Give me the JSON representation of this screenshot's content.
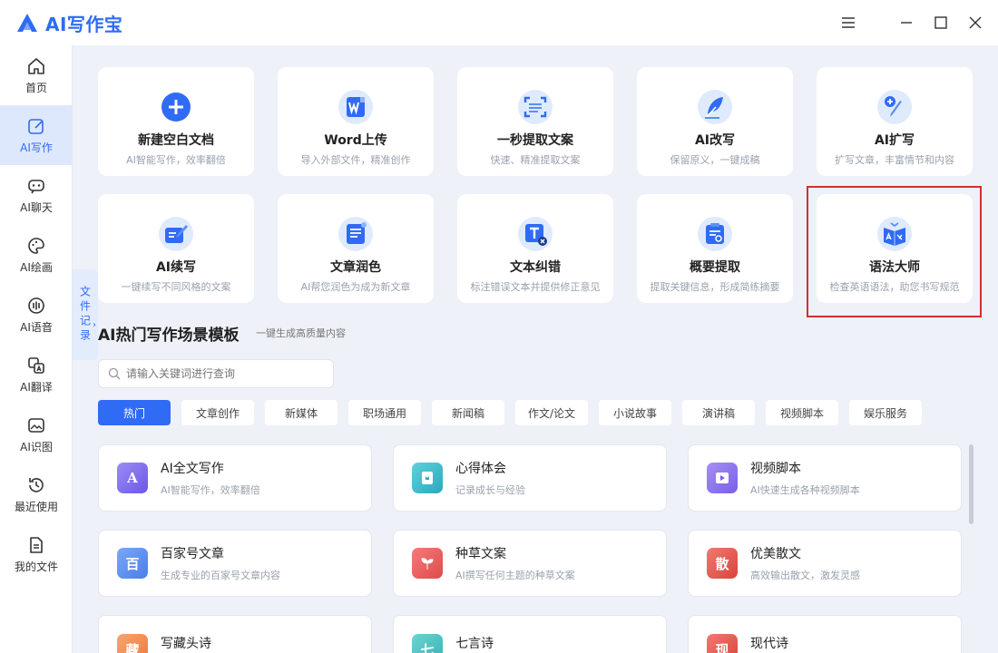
{
  "app": {
    "title": "AI写作宝"
  },
  "colors": {
    "accent": "#2f6bf5",
    "highlight": "#d32f2f"
  },
  "window_controls": [
    "menu-icon",
    "minimize-icon",
    "maximize-icon",
    "close-icon"
  ],
  "sidebar": {
    "items": [
      {
        "label": "首页",
        "icon": "home-icon"
      },
      {
        "label": "AI写作",
        "icon": "edit-icon",
        "active": true
      },
      {
        "label": "AI聊天",
        "icon": "chat-icon"
      },
      {
        "label": "AI绘画",
        "icon": "palette-icon"
      },
      {
        "label": "AI语音",
        "icon": "voice-icon"
      },
      {
        "label": "AI翻译",
        "icon": "translate-icon"
      },
      {
        "label": "AI识图",
        "icon": "image-icon"
      },
      {
        "label": "最近使用",
        "icon": "history-icon"
      },
      {
        "label": "我的文件",
        "icon": "file-icon"
      }
    ]
  },
  "side_tab": {
    "label": "文件记录"
  },
  "tools": [
    {
      "title": "新建空白文档",
      "desc": "AI智能写作，效率翻倍",
      "icon": "plus-icon"
    },
    {
      "title": "Word上传",
      "desc": "导入外部文件，精准创作",
      "icon": "word-icon"
    },
    {
      "title": "一秒提取文案",
      "desc": "快速、精准提取文案",
      "icon": "scan-icon"
    },
    {
      "title": "AI改写",
      "desc": "保留原义，一键成稿",
      "icon": "feather-icon"
    },
    {
      "title": "AI扩写",
      "desc": "扩写文章，丰富情节和内容",
      "icon": "pen-expand-icon"
    },
    {
      "title": "AI续写",
      "desc": "一键续写不同风格的文案",
      "icon": "book-pen-icon"
    },
    {
      "title": "文章润色",
      "desc": "AI帮您润色为成为新文章",
      "icon": "document-icon"
    },
    {
      "title": "文本纠错",
      "desc": "标注错误文本并提供修正意见",
      "icon": "text-check-icon"
    },
    {
      "title": "概要提取",
      "desc": "提取关键信息，形成简练摘要",
      "icon": "clipboard-search-icon"
    },
    {
      "title": "语法大师",
      "desc": "检查英语语法，助您书写规范",
      "icon": "grammar-book-icon"
    }
  ],
  "templates_section": {
    "title": "AI热门写作场景模板",
    "subtitle": "一键生成高质量内容",
    "search_placeholder": "请输入关键词进行查询",
    "chips": [
      "热门",
      "文章创作",
      "新媒体",
      "职场通用",
      "新闻稿",
      "作文/论文",
      "小说故事",
      "演讲稿",
      "视频脚本",
      "娱乐服务"
    ],
    "active_chip": "热门",
    "cards": [
      {
        "title": "AI全文写作",
        "desc": "AI智能写作，效率翻倍",
        "glyph": "A",
        "color": "#7b6cf0"
      },
      {
        "title": "心得体会",
        "desc": "记录成长与经验",
        "glyph": "▯",
        "color": "#34b7c9"
      },
      {
        "title": "视频脚本",
        "desc": "AI快速生成各种视频脚本",
        "glyph": "▶",
        "color": "#8a6ee8"
      },
      {
        "title": "百家号文章",
        "desc": "生成专业的百家号文章内容",
        "glyph": "百",
        "color": "#4f87f0"
      },
      {
        "title": "种草文案",
        "desc": "AI撰写任何主题的种草文案",
        "glyph": "❦",
        "color": "#ef5a5a"
      },
      {
        "title": "优美散文",
        "desc": "高效输出散文，激发灵感",
        "glyph": "散",
        "color": "#e85a5a"
      },
      {
        "title": "写藏头诗",
        "desc": "",
        "glyph": "藏",
        "color": "#f08a4a"
      },
      {
        "title": "七言诗",
        "desc": "",
        "glyph": "七",
        "color": "#3fbcc0"
      },
      {
        "title": "现代诗",
        "desc": "",
        "glyph": "现",
        "color": "#e85a5a"
      }
    ]
  }
}
